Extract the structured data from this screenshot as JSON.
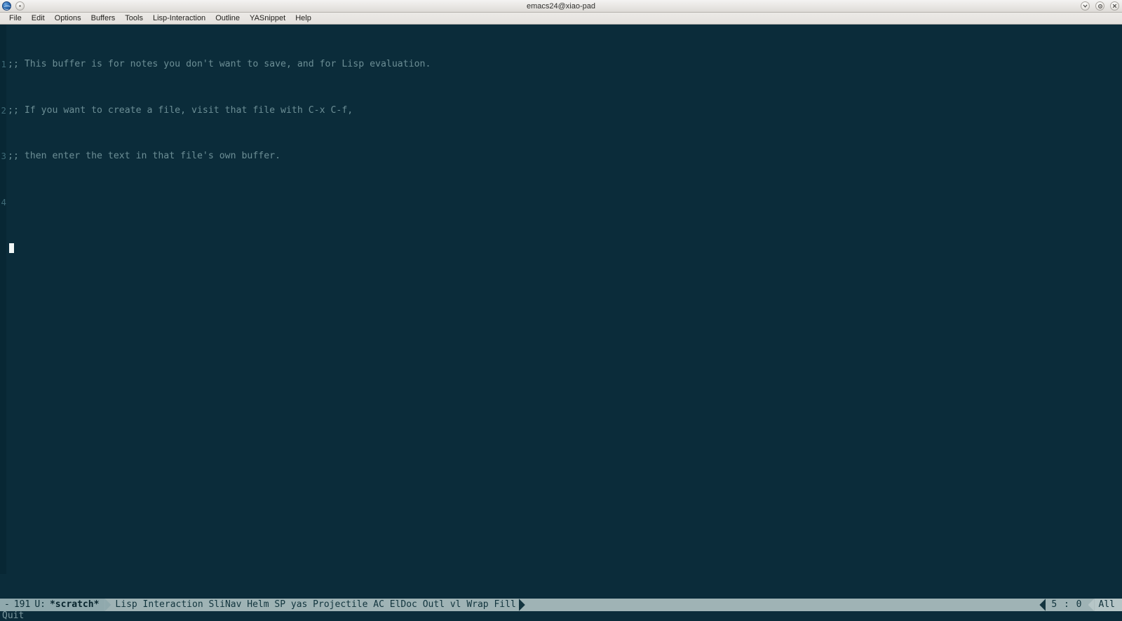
{
  "window": {
    "title": "emacs24@xiao-pad",
    "left_icons": [
      {
        "name": "emacs-globe-icon"
      },
      {
        "name": "window-menu-circle-icon"
      }
    ],
    "controls": [
      {
        "name": "minimize-button",
        "glyph": "chevron-down-icon"
      },
      {
        "name": "maximize-button",
        "glyph": "gear-icon"
      },
      {
        "name": "close-button",
        "glyph": "close-icon"
      }
    ]
  },
  "menubar": {
    "items": [
      {
        "label": "File"
      },
      {
        "label": "Edit"
      },
      {
        "label": "Options"
      },
      {
        "label": "Buffers"
      },
      {
        "label": "Tools"
      },
      {
        "label": "Lisp-Interaction"
      },
      {
        "label": "Outline"
      },
      {
        "label": "YASnippet"
      },
      {
        "label": "Help"
      }
    ]
  },
  "buffer": {
    "name": "*scratch*",
    "lines": [
      {
        "number": "1",
        "text": ";; This buffer is for notes you don't want to save, and for Lisp evaluation."
      },
      {
        "number": "2",
        "text": ";; If you want to create a file, visit that file with C-x C-f,"
      },
      {
        "number": "3",
        "text": ";; then enter the text in that file's own buffer."
      },
      {
        "number": "4",
        "text": ""
      }
    ],
    "cursor_line": "5"
  },
  "modeline": {
    "mode_indicator": "-",
    "fill_column": "191",
    "encoding_state": "U:",
    "buffer_name": "*scratch*",
    "major_mode": "Lisp Interaction",
    "minor_modes": "SliNav Helm SP yas Projectile AC ElDoc Outl vl Wrap Fill",
    "modes_text": "Lisp Interaction SliNav Helm SP yas Projectile AC ElDoc Outl vl Wrap Fill",
    "position": "5 : 0",
    "scroll_state": "All"
  },
  "echo_area": {
    "message": "Quit"
  },
  "colors": {
    "buffer_background": "#0b2c3a",
    "buffer_text": "#6c8e95",
    "linum_background": "#082734",
    "linum_text": "#3f6b78",
    "modeline_background": "#9fb3b5",
    "modeline_active_background": "#90a9ad",
    "modeline_text": "#11343d",
    "cursor": "#f2f7f7",
    "titlebar_background": "#e8e6e3",
    "menubar_background": "#e4e1dd"
  }
}
